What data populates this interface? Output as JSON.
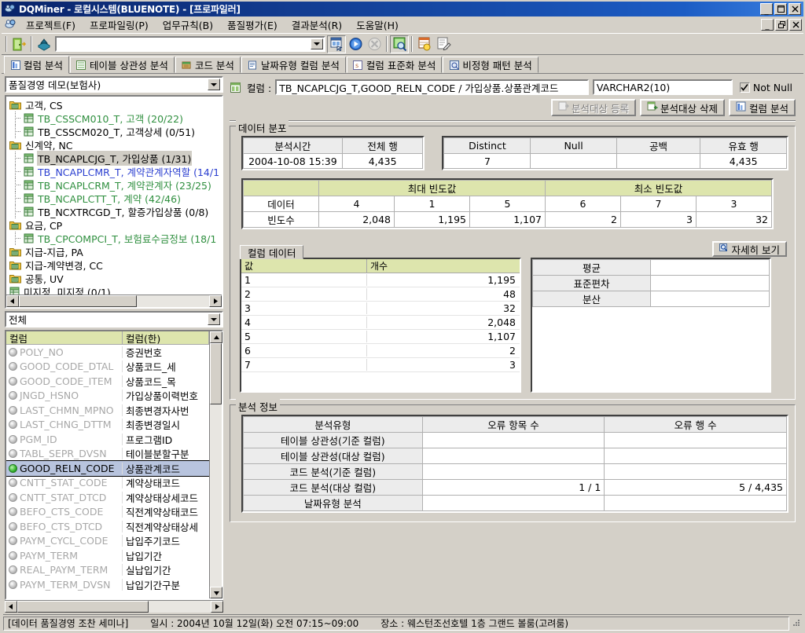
{
  "window": {
    "title": "DQMiner - 로컬시스템(BLUENOTE) - [프로파일러]",
    "app_icon": "dqminer-icon",
    "minimize": "_",
    "maximize": "□",
    "close": "✕",
    "mdi_minimize": "_",
    "mdi_restore": "❐",
    "mdi_close": "✕"
  },
  "menu": [
    {
      "label": "프로젝트(F)",
      "accel": "F"
    },
    {
      "label": "프로파일링(P)",
      "accel": "P"
    },
    {
      "label": "업무규칙(B)",
      "accel": "B"
    },
    {
      "label": "품질평가(E)",
      "accel": "E"
    },
    {
      "label": "결과분석(R)",
      "accel": "R"
    },
    {
      "label": "도움말(H)",
      "accel": "H"
    }
  ],
  "toolbar": {
    "exit_icon": "exit-door-icon",
    "db_icon": "database-icon",
    "combo_value": "",
    "combo_placeholder": "",
    "profile_icon": "profile-window-icon",
    "run_icon": "run-play-icon",
    "stop_icon": "stop-cancel-icon",
    "analysis_icon": "analysis-search-icon",
    "report_icon": "report-grid-icon",
    "edit_icon": "edit-note-icon"
  },
  "tabs": [
    {
      "label": "컬럼 분석",
      "icon": "column-analysis-icon",
      "active": true
    },
    {
      "label": "테이블 상관성 분석",
      "icon": "table-correlation-icon",
      "active": false
    },
    {
      "label": "코드 분석",
      "icon": "code-analysis-icon",
      "active": false
    },
    {
      "label": "날짜유형 컬럼 분석",
      "icon": "date-type-icon",
      "active": false
    },
    {
      "label": "컬럼 표준화 분석",
      "icon": "standardize-icon",
      "active": false
    },
    {
      "label": "비정형 패턴 분석",
      "icon": "pattern-icon",
      "active": false
    }
  ],
  "sidebar": {
    "project_combo": "품질경영 데모(보험사)",
    "tree": [
      {
        "label": "고객, CS",
        "level": 0,
        "icon": "folder-icon",
        "color": "black",
        "selected": false
      },
      {
        "label": "TB_CSSCM010_T, 고객 (20/22)",
        "level": 1,
        "icon": "table-icon",
        "color": "green",
        "selected": false
      },
      {
        "label": "TB_CSSCM020_T, 고객상세 (0/51)",
        "level": 1,
        "icon": "table-icon",
        "color": "black",
        "selected": false
      },
      {
        "label": "신계약, NC",
        "level": 0,
        "icon": "folder-icon",
        "color": "black",
        "selected": false
      },
      {
        "label": "TB_NCAPLCJG_T, 가입상품 (1/31)",
        "level": 1,
        "icon": "table-icon",
        "color": "black",
        "selected": true
      },
      {
        "label": "TB_NCAPLCMR_T, 계약관계자역할 (14/1",
        "level": 1,
        "icon": "table-icon",
        "color": "blue",
        "selected": false
      },
      {
        "label": "TB_NCAPLCRM_T, 계약관계자 (23/25)",
        "level": 1,
        "icon": "table-icon",
        "color": "green",
        "selected": false
      },
      {
        "label": "TB_NCAPLCTT_T, 계약 (42/46)",
        "level": 1,
        "icon": "table-icon",
        "color": "green",
        "selected": false
      },
      {
        "label": "TB_NCXTRCGD_T, 할증가입상품 (0/8)",
        "level": 1,
        "icon": "table-icon",
        "color": "black",
        "selected": false
      },
      {
        "label": "요금, CP",
        "level": 0,
        "icon": "folder-icon",
        "color": "black",
        "selected": false
      },
      {
        "label": "TB_CPCOMPCI_T, 보험료수금정보 (18/1",
        "level": 1,
        "icon": "table-icon",
        "color": "green",
        "selected": false
      },
      {
        "label": "지급-지급, PA",
        "level": 0,
        "icon": "folder-icon",
        "color": "black",
        "selected": false
      },
      {
        "label": "지급-계약변경, CC",
        "level": 0,
        "icon": "folder-icon",
        "color": "black",
        "selected": false
      },
      {
        "label": "공통, UV",
        "level": 0,
        "icon": "folder-icon",
        "color": "black",
        "selected": false
      },
      {
        "label": "미지정, 미지정 (0/1)",
        "level": 0,
        "icon": "table-icon",
        "color": "black",
        "selected": false
      }
    ],
    "filter_combo": "전체",
    "grid_headers": [
      "컬럼",
      "컬럼(한)"
    ],
    "columns": [
      {
        "name": "POLY_NO",
        "korean": "증권번호",
        "analyzed": false,
        "selected": false
      },
      {
        "name": "GOOD_CODE_DTAL",
        "korean": "상품코드_세",
        "analyzed": false,
        "selected": false
      },
      {
        "name": "GOOD_CODE_ITEM",
        "korean": "상품코드_목",
        "analyzed": false,
        "selected": false
      },
      {
        "name": "JNGD_HSNO",
        "korean": "가입상품이력번호",
        "analyzed": false,
        "selected": false
      },
      {
        "name": "LAST_CHMN_MPNO",
        "korean": "최종변경자사번",
        "analyzed": false,
        "selected": false
      },
      {
        "name": "LAST_CHNG_DTTM",
        "korean": "최종변경일시",
        "analyzed": false,
        "selected": false
      },
      {
        "name": "PGM_ID",
        "korean": "프로그램ID",
        "analyzed": false,
        "selected": false
      },
      {
        "name": "TABL_SEPR_DVSN",
        "korean": "테이블분할구분",
        "analyzed": false,
        "selected": false
      },
      {
        "name": "GOOD_RELN_CODE",
        "korean": "상품관계코드",
        "analyzed": true,
        "selected": true
      },
      {
        "name": "CNTT_STAT_CODE",
        "korean": "계약상태코드",
        "analyzed": false,
        "selected": false
      },
      {
        "name": "CNTT_STAT_DTCD",
        "korean": "계약상태상세코드",
        "analyzed": false,
        "selected": false
      },
      {
        "name": "BEFO_CTS_CODE",
        "korean": "직전계약상태코드",
        "analyzed": false,
        "selected": false
      },
      {
        "name": "BEFO_CTS_DTCD",
        "korean": "직전계약상태상세",
        "analyzed": false,
        "selected": false
      },
      {
        "name": "PAYM_CYCL_CODE",
        "korean": "납입주기코드",
        "analyzed": false,
        "selected": false
      },
      {
        "name": "PAYM_TERM",
        "korean": "납입기간",
        "analyzed": false,
        "selected": false
      },
      {
        "name": "REAL_PAYM_TERM",
        "korean": "실납입기간",
        "analyzed": false,
        "selected": false
      },
      {
        "name": "PAYM_TERM_DVSN",
        "korean": "납입기간구분",
        "analyzed": false,
        "selected": false
      }
    ]
  },
  "column_info": {
    "icon": "column-icon",
    "label": "컬럼 :",
    "full_name": "TB_NCAPLCJG_T,GOOD_RELN_CODE / 가입상품.상품관계코드",
    "data_type": "VARCHAR2(10)",
    "not_null_label": "Not Null",
    "not_null_checked": true,
    "buttons": [
      {
        "label": "분석대상 등록",
        "icon": "register-icon",
        "disabled": true
      },
      {
        "label": "분석대상 삭제",
        "icon": "delete-target-icon",
        "disabled": false
      },
      {
        "label": "컬럼 분석",
        "icon": "column-analysis-icon",
        "disabled": false
      }
    ]
  },
  "distribution": {
    "group_title": "데이터 분포",
    "left_table": {
      "headers": [
        "분석시간",
        "전체 행"
      ],
      "values": [
        "2004-10-08 15:39",
        "4,435"
      ]
    },
    "right_table": {
      "headers": [
        "Distinct",
        "Null",
        "공백",
        "유효 행"
      ],
      "values": [
        "7",
        "",
        "",
        "4,435"
      ]
    },
    "freq_table": {
      "corner": "",
      "group_headers": [
        "최대 빈도값",
        "최소 빈도값"
      ],
      "row_labels": [
        "데이터",
        "빈도수"
      ],
      "max_freq_data": [
        "4",
        "1",
        "5"
      ],
      "max_freq_counts": [
        "2,048",
        "1,195",
        "1,107"
      ],
      "min_freq_data": [
        "6",
        "7",
        "3"
      ],
      "min_freq_counts": [
        "2",
        "3",
        "32"
      ]
    }
  },
  "column_data": {
    "tab_label": "컬럼 데이터",
    "detail_button": {
      "label": "자세히 보기",
      "icon": "magnifier-icon"
    },
    "headers": [
      "값",
      "개수"
    ],
    "rows": [
      {
        "value": "1",
        "count": "1,195"
      },
      {
        "value": "2",
        "count": "48"
      },
      {
        "value": "3",
        "count": "32"
      },
      {
        "value": "4",
        "count": "2,048"
      },
      {
        "value": "5",
        "count": "1,107"
      },
      {
        "value": "6",
        "count": "2"
      },
      {
        "value": "7",
        "count": "3"
      }
    ],
    "stats": [
      {
        "label": "평균",
        "value": ""
      },
      {
        "label": "표준편차",
        "value": ""
      },
      {
        "label": "분산",
        "value": ""
      }
    ]
  },
  "analysis_info": {
    "group_title": "분석 정보",
    "headers": [
      "분석유형",
      "오류 항목 수",
      "오류 행 수"
    ],
    "rows": [
      {
        "type": "테이블 상관성(기준 컬럼)",
        "error_items": "",
        "error_rows": ""
      },
      {
        "type": "테이블 상관성(대상 컬럼)",
        "error_items": "",
        "error_rows": ""
      },
      {
        "type": "코드 분석(기준 컬럼)",
        "error_items": "",
        "error_rows": ""
      },
      {
        "type": "코드 분석(대상 컬럼)",
        "error_items": "1 / 1",
        "error_rows": "5 / 4,435"
      },
      {
        "type": "날짜유형 분석",
        "error_items": "",
        "error_rows": ""
      }
    ]
  },
  "statusbar": {
    "seminar": "[데이터 품질경영 조찬 세미나]",
    "datetime": "일시 : 2004년 10월 12일(화) 오전 07:15~09:00",
    "location": "장소 : 웨스턴조선호텔 1층 그랜드 볼룸(고려룸)"
  },
  "colors": {
    "face": "#d4d0c8",
    "title_start": "#0a246a",
    "title_end": "#3a80e0",
    "grid_header_green": "#dde5ad",
    "selection": "#b8c4de",
    "green_text": "#2f8f3f",
    "blue_text": "#2b3fd0"
  }
}
